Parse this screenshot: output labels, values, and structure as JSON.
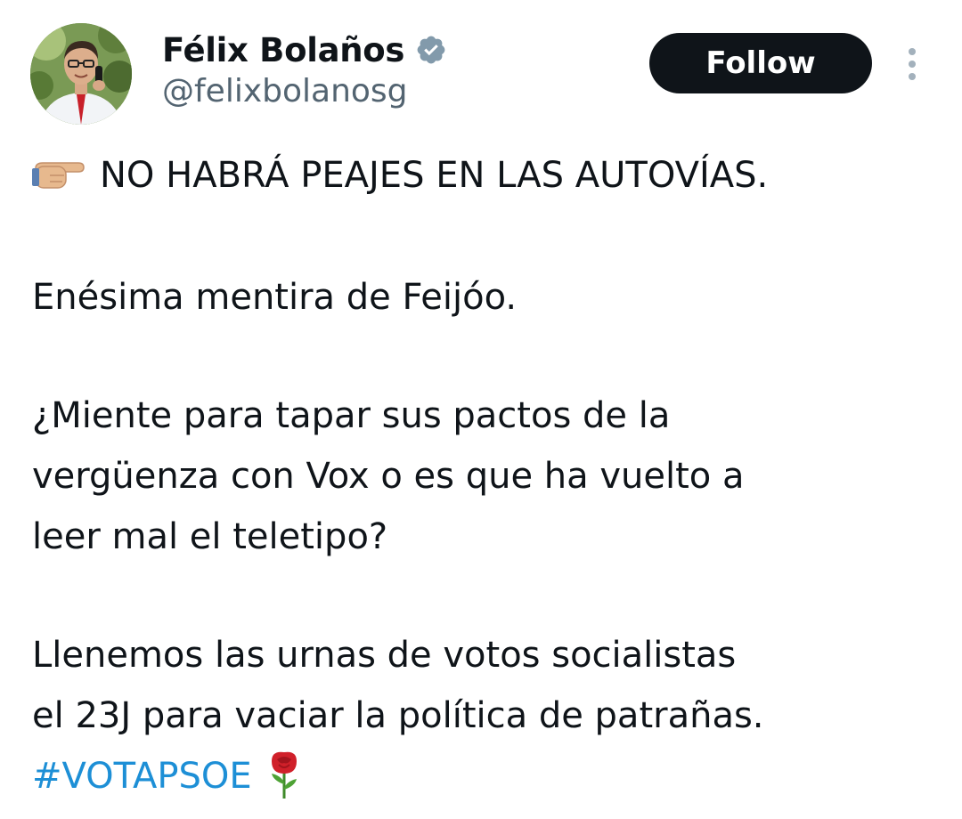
{
  "author": {
    "display_name": "Félix Bolaños",
    "handle": "@felixbolanosg",
    "verified_icon": "verified-badge-icon",
    "avatar_icon": "profile-photo"
  },
  "actions": {
    "follow_label": "Follow",
    "more_icon": "more-vertical-icon"
  },
  "tweet": {
    "line1": "NO HABRÁ PEAJES EN LAS AUTOVÍAS.",
    "line1_icon": "backhand-index-pointing-right-emoji",
    "line2": "Enésima mentira de Feijóo.",
    "line3a": "¿Miente para tapar sus pactos de la",
    "line3b": "vergüenza con Vox o es que ha vuelto a",
    "line3c": "leer mal el teletipo?",
    "line4a": "Llenemos las urnas de votos socialistas",
    "line4b": "el 23J para vaciar la política de patrañas.",
    "hashtag": "#VOTAPSOE",
    "hashtag_icon": "rose-emoji"
  },
  "colors": {
    "text": "#0f1419",
    "secondary": "#536471",
    "link": "#1d8fd6",
    "button_bg": "#0f1419",
    "verified_badge": "#829aab"
  }
}
